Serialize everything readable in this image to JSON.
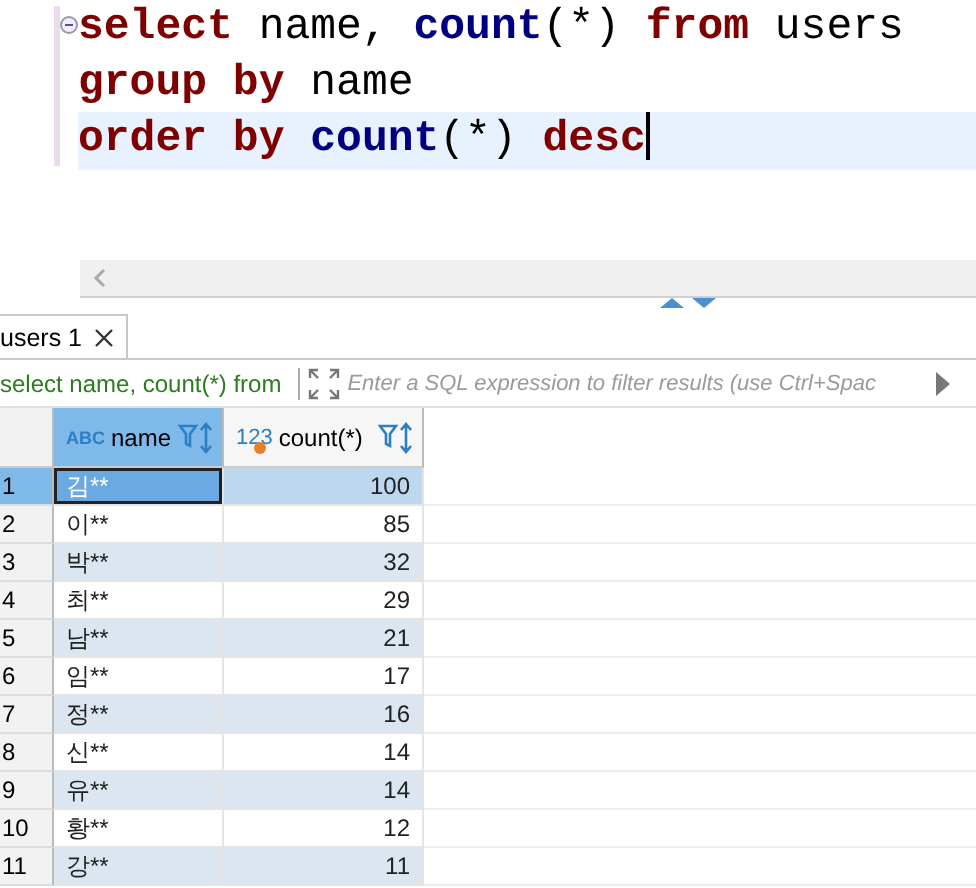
{
  "editor": {
    "lines": [
      {
        "folded": false,
        "current": false,
        "cursor": false,
        "tokens": [
          {
            "text": "select",
            "kind": "keyword"
          },
          {
            "text": "name,",
            "kind": "plain"
          },
          {
            "text": "count",
            "kind": "function"
          },
          {
            "text": "(*)",
            "kind": "plain",
            "joined": true
          },
          {
            "text": "from",
            "kind": "keyword"
          },
          {
            "text": "users",
            "kind": "plain"
          }
        ]
      },
      {
        "current": false,
        "cursor": false,
        "tokens": [
          {
            "text": "group",
            "kind": "keyword"
          },
          {
            "text": "by",
            "kind": "keyword"
          },
          {
            "text": "name",
            "kind": "plain"
          }
        ]
      },
      {
        "current": true,
        "cursor": true,
        "tokens": [
          {
            "text": "order",
            "kind": "keyword"
          },
          {
            "text": "by",
            "kind": "keyword"
          },
          {
            "text": "count",
            "kind": "function"
          },
          {
            "text": "(*)",
            "kind": "plain",
            "joined": true
          },
          {
            "text": "desc",
            "kind": "keyword"
          }
        ]
      }
    ]
  },
  "results": {
    "tabs": [
      {
        "label": "users 1",
        "selected": true
      }
    ],
    "filter": {
      "query": "select name, count(*) from",
      "placeholder": "Enter a SQL expression to filter results (use Ctrl+Spac"
    },
    "columns": [
      {
        "label": "name",
        "type": "ABC",
        "selected": true
      },
      {
        "label": "count(*)",
        "type": "123",
        "selected": false
      }
    ],
    "rows": [
      {
        "number": "1",
        "name": "김**",
        "count": "100",
        "selected": true
      },
      {
        "number": "2",
        "name": "이**",
        "count": "85",
        "selected": false
      },
      {
        "number": "3",
        "name": "박**",
        "count": "32",
        "selected": false
      },
      {
        "number": "4",
        "name": "최**",
        "count": "29",
        "selected": false
      },
      {
        "number": "5",
        "name": "남**",
        "count": "21",
        "selected": false
      },
      {
        "number": "6",
        "name": "임**",
        "count": "17",
        "selected": false
      },
      {
        "number": "7",
        "name": "정**",
        "count": "16",
        "selected": false
      },
      {
        "number": "8",
        "name": "신**",
        "count": "14",
        "selected": false
      },
      {
        "number": "9",
        "name": "유**",
        "count": "14",
        "selected": false
      },
      {
        "number": "10",
        "name": "황**",
        "count": "12",
        "selected": false
      },
      {
        "number": "11",
        "name": "강**",
        "count": "11",
        "selected": false
      }
    ]
  }
}
